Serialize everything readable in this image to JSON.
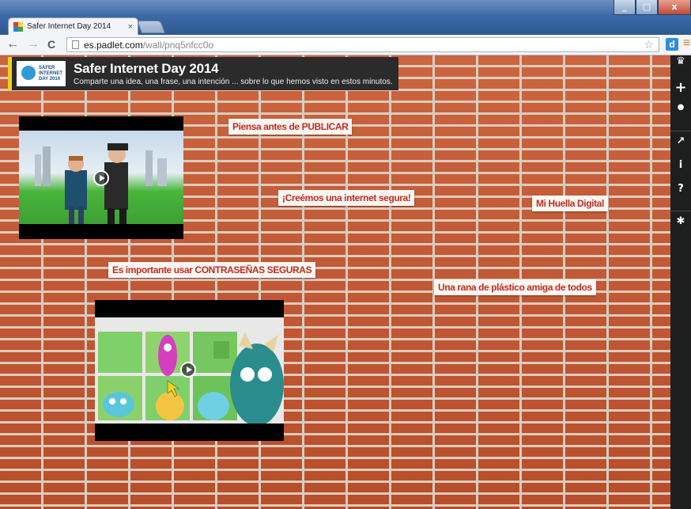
{
  "browser": {
    "tab_title": "Safer Internet Day 2014",
    "tab_close": "×",
    "url_host": "es.padlet.com",
    "url_path": "/wall/pnq5nfcc0o",
    "back": "←",
    "forward": "→",
    "reload": "C",
    "star": "☆",
    "ext_label": "d",
    "menu": "≡",
    "win_minimize": "_",
    "win_maximize": "□",
    "win_close": "x"
  },
  "wall": {
    "title": "Safer Internet Day 2014",
    "description": "Comparte una idea, una frase, una intención ... sobre lo que hemos visto en estos minutos.",
    "thumb_text": "SAFER INTERNET DAY 2014"
  },
  "notes": [
    "Piensa antes de PUBLICAR",
    "¡Creémos una internet segura!",
    "Mi Huella Digital",
    "Es importante usar CONTRASEÑAS SEGURAS",
    "Una rana de plástico amiga de todos"
  ],
  "sidebar": {
    "icons": [
      "crown-icon",
      "plus-icon",
      "user-icon",
      "share-icon",
      "info-icon",
      "help-icon",
      "gear-icon"
    ],
    "glyphs": [
      "♛",
      "+",
      "●",
      "↗",
      "i",
      "?",
      "✱"
    ]
  },
  "colors": {
    "note_text": "#c42b1f",
    "header_accent": "#f0d11c",
    "brick": "#c35a36"
  }
}
